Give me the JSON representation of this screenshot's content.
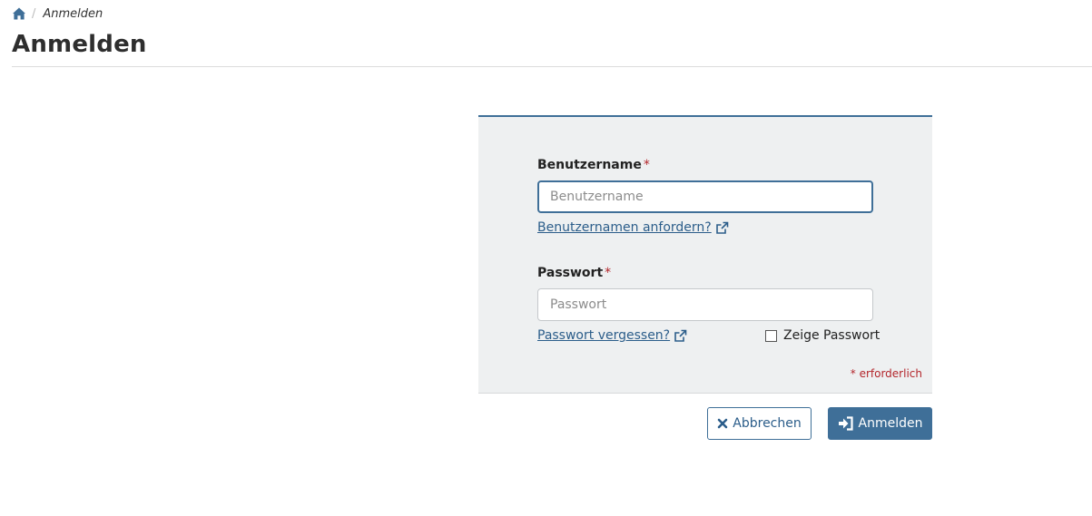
{
  "breadcrumb": {
    "home_icon": "home-icon",
    "separator": "/",
    "current": "Anmelden"
  },
  "page": {
    "title": "Anmelden"
  },
  "form": {
    "username": {
      "label": "Benutzername",
      "required_marker": "*",
      "placeholder": "Benutzername",
      "value": "",
      "help_link": "Benutzernamen anfordern?",
      "help_icon": "external-link-icon"
    },
    "password": {
      "label": "Passwort",
      "required_marker": "*",
      "placeholder": "Passwort",
      "value": "",
      "help_link": "Passwort vergessen?",
      "help_icon": "external-link-icon"
    },
    "show_password": {
      "label": "Zeige Passwort",
      "checked": false
    },
    "required_note": "* erforderlich"
  },
  "actions": {
    "cancel_label": "Abbrechen",
    "cancel_icon": "close-icon",
    "login_label": "Anmelden",
    "login_icon": "sign-in-icon"
  },
  "colors": {
    "accent": "#3f6f98",
    "link": "#2b5d8a",
    "required": "#b3262b",
    "panel_background": "#eef0f1"
  }
}
